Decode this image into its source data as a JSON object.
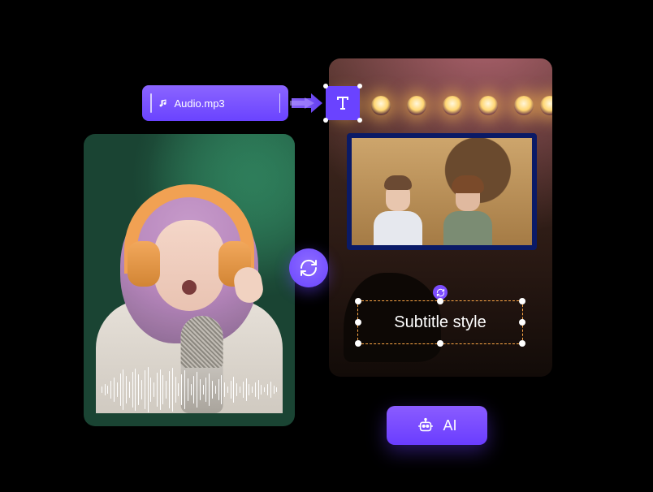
{
  "audio_chip": {
    "filename": "Audio.mp3"
  },
  "subtitle": {
    "text": "Subtitle style"
  },
  "ai_button": {
    "label": "AI"
  },
  "icons": {
    "music": "music-note-icon",
    "text": "text-T-icon",
    "swap": "swap-arrows-icon",
    "refresh": "refresh-icon",
    "robot": "robot-icon",
    "arrow": "flow-arrow-icon"
  },
  "colors": {
    "accent": "#6a43ff",
    "accent_light": "#8b65ff",
    "selection": "#ffa846"
  }
}
